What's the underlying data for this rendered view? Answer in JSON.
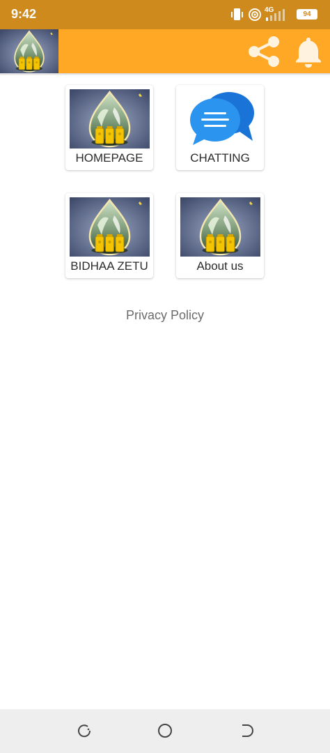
{
  "status_bar": {
    "time": "9:42",
    "network": "4G",
    "battery": "94",
    "icons": [
      "vibrate-icon",
      "hotspot-icon",
      "signal-icon",
      "battery-icon"
    ]
  },
  "app_bar": {
    "logo": "aloe-drop-logo",
    "actions": [
      "share-icon",
      "notification-bell-icon"
    ],
    "color": "#ffa826"
  },
  "menu": {
    "items": [
      {
        "label": "HOMEPAGE",
        "image": "aloe-drop-product-image"
      },
      {
        "label": "CHATTING",
        "image": "chat-bubbles-icon"
      },
      {
        "label": "BIDHAA ZETU",
        "image": "aloe-drop-product-image"
      },
      {
        "label": "About us",
        "image": "aloe-drop-product-image"
      }
    ]
  },
  "footer": {
    "privacy_link": "Privacy Policy"
  },
  "nav_bar": {
    "buttons": [
      "recents-icon",
      "home-icon",
      "back-icon"
    ]
  },
  "colors": {
    "status_bar": "#cf8a1d",
    "accent": "#ffa826",
    "chat_blue": "#1f8fe8"
  }
}
